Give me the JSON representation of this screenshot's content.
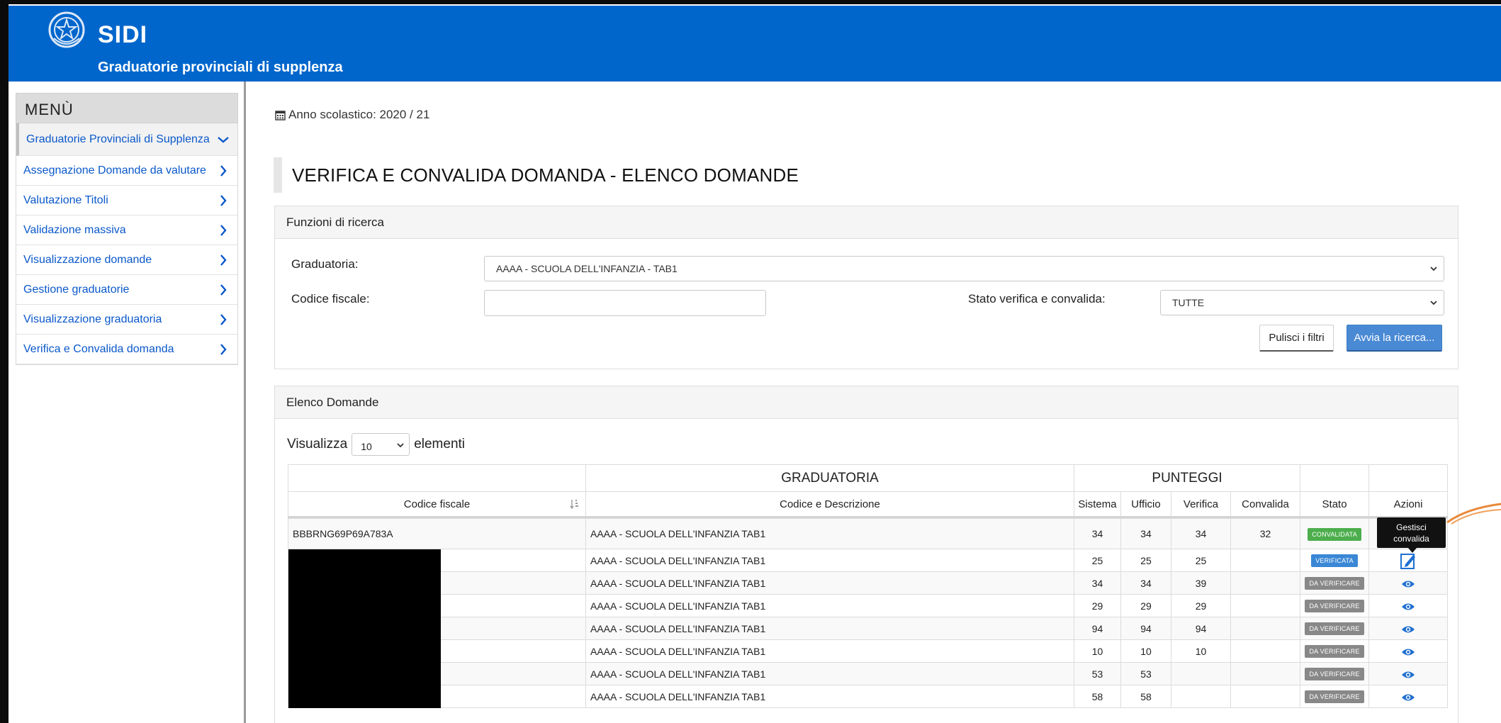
{
  "header": {
    "title": "SIDI",
    "subtitle": "Graduatorie provinciali di supplenza"
  },
  "sidebar": {
    "menu_title": "MENÙ",
    "items": [
      {
        "label": "Graduatorie Provinciali di Supplenza",
        "active": true,
        "icon": "chevron-down-icon"
      },
      {
        "label": "Assegnazione Domande da valutare",
        "icon": "chevron-right-icon"
      },
      {
        "label": "Valutazione Titoli",
        "icon": "chevron-right-icon"
      },
      {
        "label": "Validazione massiva",
        "icon": "chevron-right-icon"
      },
      {
        "label": "Visualizzazione domande",
        "icon": "chevron-right-icon"
      },
      {
        "label": "Gestione graduatorie",
        "icon": "chevron-right-icon"
      },
      {
        "label": "Visualizzazione graduatoria",
        "icon": "chevron-right-icon"
      },
      {
        "label": "Verifica e Convalida domanda",
        "icon": "chevron-right-icon"
      }
    ]
  },
  "main": {
    "school_year": "Anno scolastico: 2020 / 21",
    "page_title": "VERIFICA E CONVALIDA DOMANDA - ELENCO DOMANDE"
  },
  "search": {
    "panel_title": "Funzioni di ricerca",
    "graduatoria_label": "Graduatoria:",
    "graduatoria_value": "AAAA - SCUOLA DELL'INFANZIA - TAB1",
    "codice_label": "Codice fiscale:",
    "codice_value": "",
    "stato_label": "Stato verifica e convalida:",
    "stato_value": "TUTTE",
    "clear_button": "Pulisci i filtri",
    "search_button": "Avvia la ricerca..."
  },
  "list": {
    "panel_title": "Elenco Domande",
    "show_label": "Visualizza",
    "show_value": "10",
    "elements_label": "elementi",
    "group_graduatoria": "GRADUATORIA",
    "group_punteggi": "PUNTEGGI",
    "columns": [
      "Codice fiscale",
      "Codice e Descrizione",
      "Sistema",
      "Ufficio",
      "Verifica",
      "Convalida",
      "Stato",
      "Azioni"
    ],
    "rows": [
      {
        "cf": "BBBRNG69P69A783A",
        "desc": "AAAA - SCUOLA DELL'INFANZIA TAB1",
        "sistema": "34",
        "ufficio": "34",
        "verifica": "34",
        "convalida": "32",
        "stato": "CONVALIDATA",
        "action": "view"
      },
      {
        "cf": "",
        "desc": "AAAA - SCUOLA DELL'INFANZIA TAB1",
        "sistema": "25",
        "ufficio": "25",
        "verifica": "25",
        "convalida": "",
        "stato": "VERIFICATA",
        "action": "edit"
      },
      {
        "cf": "",
        "desc": "AAAA - SCUOLA DELL'INFANZIA TAB1",
        "sistema": "34",
        "ufficio": "34",
        "verifica": "39",
        "convalida": "",
        "stato": "DA VERIFICARE",
        "action": "view"
      },
      {
        "cf": "",
        "desc": "AAAA - SCUOLA DELL'INFANZIA TAB1",
        "sistema": "29",
        "ufficio": "29",
        "verifica": "29",
        "convalida": "",
        "stato": "DA VERIFICARE",
        "action": "view"
      },
      {
        "cf": "",
        "desc": "AAAA - SCUOLA DELL'INFANZIA TAB1",
        "sistema": "94",
        "ufficio": "94",
        "verifica": "94",
        "convalida": "",
        "stato": "DA VERIFICARE",
        "action": "view"
      },
      {
        "cf": "",
        "desc": "AAAA - SCUOLA DELL'INFANZIA TAB1",
        "sistema": "10",
        "ufficio": "10",
        "verifica": "10",
        "convalida": "",
        "stato": "DA VERIFICARE",
        "action": "view"
      },
      {
        "cf": "",
        "desc": "AAAA - SCUOLA DELL'INFANZIA TAB1",
        "sistema": "53",
        "ufficio": "53",
        "verifica": "",
        "convalida": "",
        "stato": "DA VERIFICARE",
        "action": "view"
      },
      {
        "cf": "",
        "desc": "AAAA - SCUOLA DELL'INFANZIA TAB1",
        "sistema": "58",
        "ufficio": "58",
        "verifica": "",
        "convalida": "",
        "stato": "DA VERIFICARE",
        "action": "view"
      }
    ]
  },
  "tooltip": {
    "text_line1": "Gestisci",
    "text_line2": "convalida"
  },
  "colors": {
    "header_bg": "#0066cc",
    "link": "#0a58ca",
    "badge_green": "#4cae4c",
    "badge_blue": "#3a87d6",
    "badge_gray": "#888888",
    "button_primary": "#4a8ad4"
  }
}
